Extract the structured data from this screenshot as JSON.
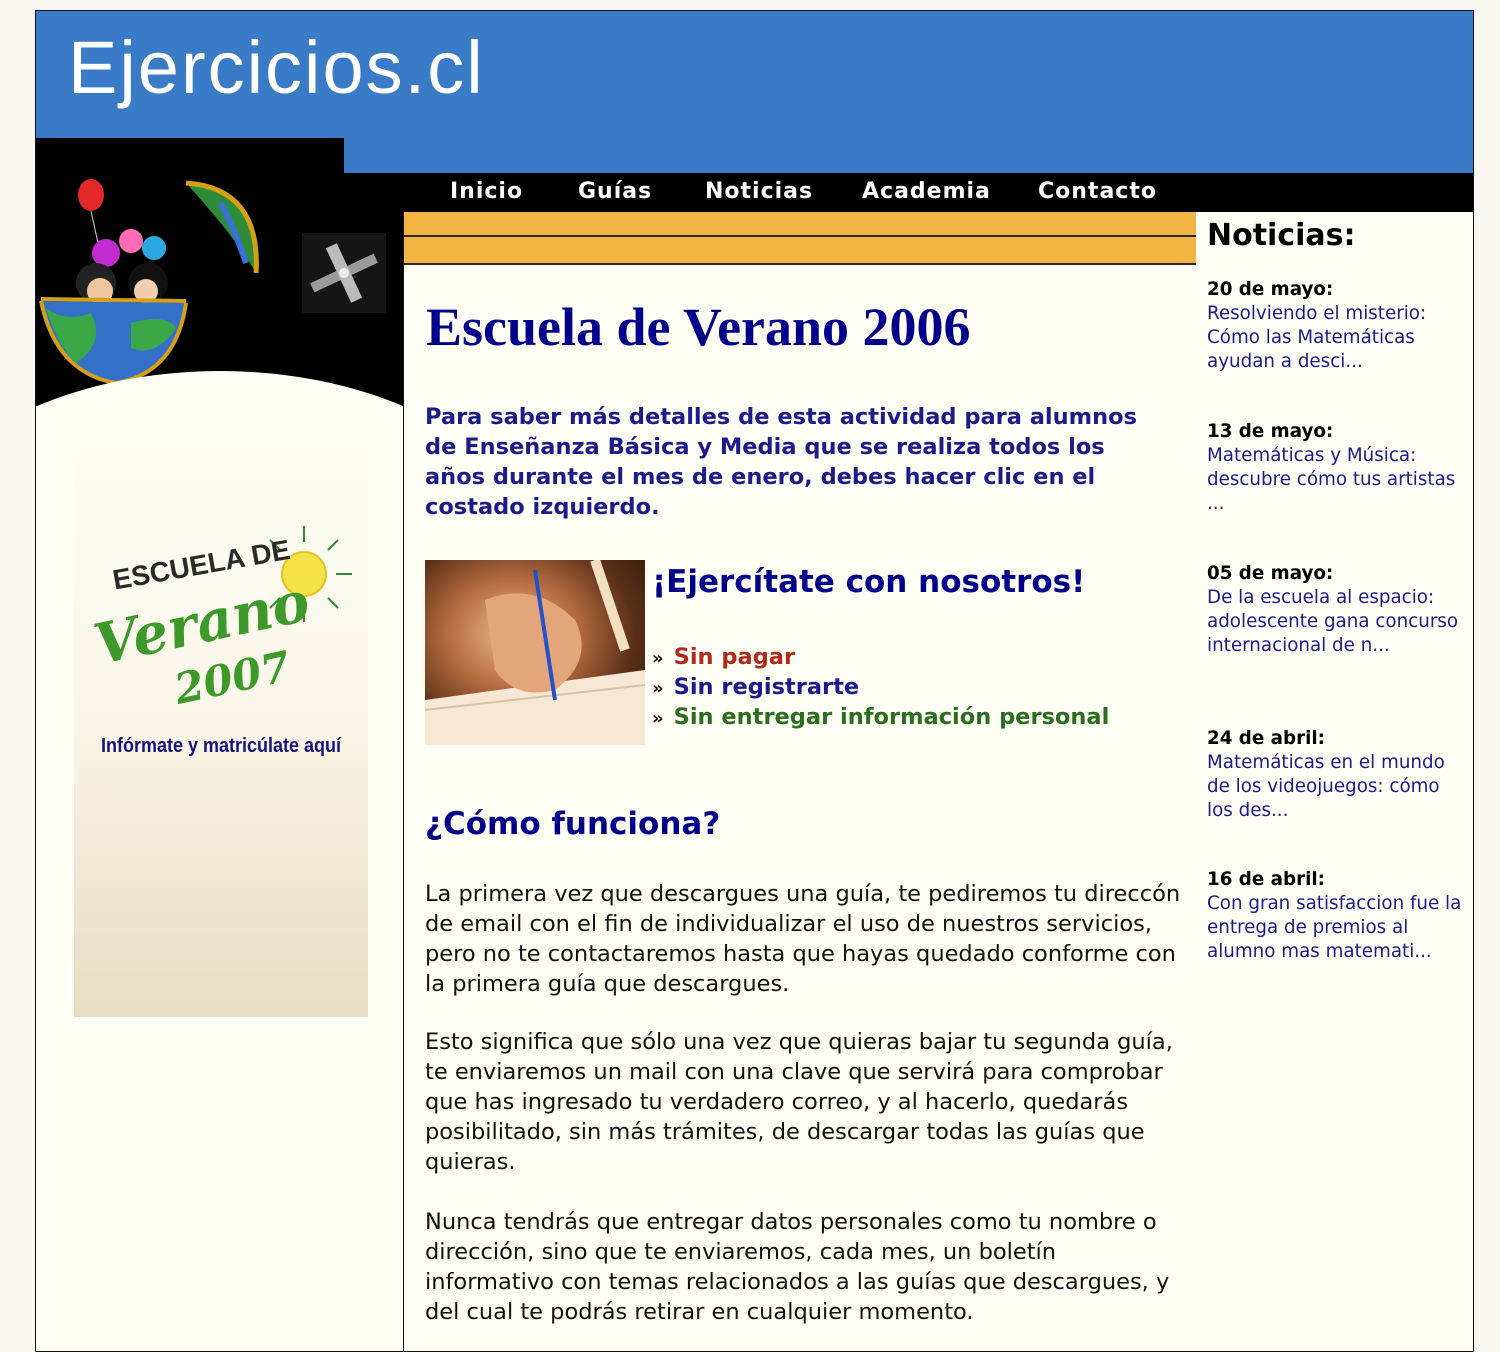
{
  "site": {
    "title": "Ejercicios.cl"
  },
  "nav": {
    "items": [
      {
        "label": "Inicio"
      },
      {
        "label": "Guías"
      },
      {
        "label": "Noticias"
      },
      {
        "label": "Academia"
      },
      {
        "label": "Contacto"
      }
    ]
  },
  "left_ad": {
    "line1": "ESCUELA DE",
    "line2": "Verano",
    "line3": "2007",
    "subtitle": "Infórmate y matricúlate aquí"
  },
  "main": {
    "title": "Escuela de Verano 2006",
    "intro": "Para saber más detalles de esta actividad para alumnos de Enseñanza Básica y Media que se realiza todos los años durante el mes de enero, debes hacer clic en el costado izquierdo.",
    "ejercitate_title": "¡Ejercítate con nosotros!",
    "features": [
      {
        "arrow": "»",
        "text": "Sin pagar",
        "color": "#b22a1a"
      },
      {
        "arrow": "»",
        "text": "Sin registrarte",
        "color": "#1b1b8a"
      },
      {
        "arrow": "»",
        "text": "Sin entregar información personal",
        "color": "#2c6e1f"
      }
    ],
    "como_title": "¿Cómo funciona?",
    "paragraphs": [
      "La primera vez que descargues una guía, te pediremos tu direccón de email con el fin de individualizar el uso de nuestros servicios, pero no te contactaremos hasta que hayas quedado conforme con la primera guía que descargues.",
      "Esto significa que sólo una vez que quieras bajar tu segunda guía, te enviaremos un mail con una clave que servirá para comprobar que has ingresado tu verdadero correo, y al hacerlo, quedarás posibilitado, sin más trámites, de descargar todas las guías que quieras.",
      "Nunca tendrás que entregar datos personales como tu nombre o dirección, sino que te enviaremos, cada mes, un boletín informativo con temas relacionados a las guías que descargues, y del cual te podrás retirar en cualquier momento."
    ]
  },
  "news": {
    "title": "Noticias:",
    "items": [
      {
        "date": "20 de mayo:",
        "text": "Resolviendo el misterio: Cómo las Matemáticas ayudan a desci..."
      },
      {
        "date": "13 de mayo:",
        "text": "Matemáticas y Música: descubre cómo tus artistas ..."
      },
      {
        "date": "05 de mayo:",
        "text": "De la escuela al espacio: adolescente gana concurso internacional de n..."
      },
      {
        "date": "24 de abril:",
        "text": "Matemáticas en el mundo de los videojuegos: cómo los des..."
      },
      {
        "date": "16 de abril:",
        "text": "Con gran satisfaccion fue la entrega de premios al alumno mas matemati..."
      }
    ]
  },
  "colors": {
    "banner": "#3a7bc8",
    "navbar": "#000000",
    "accent_stripe": "#f2b443",
    "heading": "#00008b",
    "page_bg": "#fffef5"
  }
}
